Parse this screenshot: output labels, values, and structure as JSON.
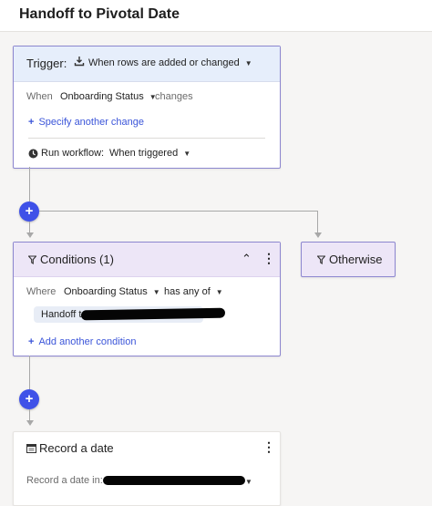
{
  "header": {
    "title": "Handoff to Pivotal Date"
  },
  "trigger": {
    "label": "Trigger:",
    "type": "When rows are added or changed",
    "when_label": "When",
    "column": "Onboarding Status",
    "changes_label": "changes",
    "add_change": "Specify another change",
    "run_label": "Run workflow:",
    "run_value": "When triggered"
  },
  "conditions": {
    "title": "Conditions (1)",
    "where_label": "Where",
    "column": "Onboarding Status",
    "operator": "has any of",
    "value_prefix": "Handoff to",
    "add_condition": "Add another condition"
  },
  "otherwise": {
    "title": "Otherwise"
  },
  "record": {
    "title": "Record a date",
    "field_label": "Record a date in:"
  },
  "icons": {
    "trigger": "download-icon",
    "clock": "clock-icon",
    "filter": "filter-icon",
    "calendar": "calendar-icon",
    "plus": "plus-icon",
    "more": "more-vertical-icon",
    "collapse": "chevron-up-icon"
  },
  "colors": {
    "accent": "#3f51e8",
    "link": "#3b55d9",
    "trigger_header": "#e6eefb",
    "condition_header": "#ede6f7"
  }
}
